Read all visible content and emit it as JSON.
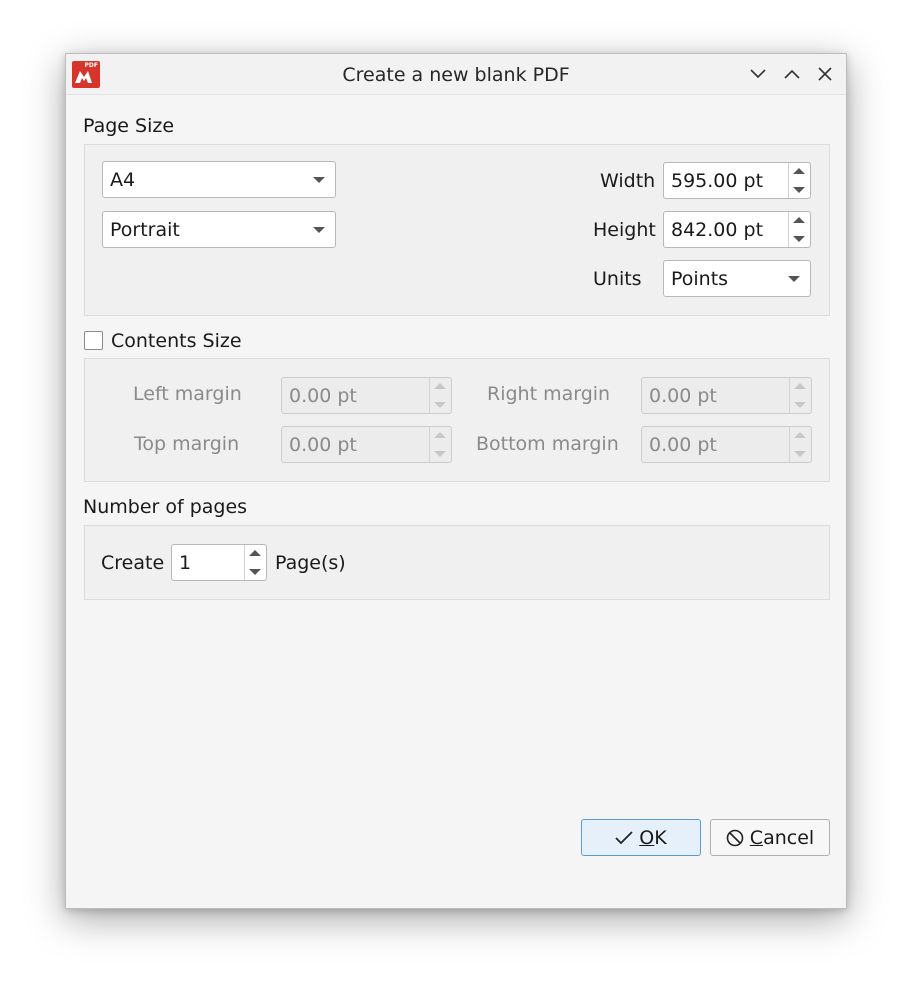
{
  "window": {
    "title": "Create a new blank PDF",
    "app_icon_tag": "PDF",
    "controls": [
      "chevron-down",
      "chevron-up",
      "close"
    ]
  },
  "page_size": {
    "group_label": "Page Size",
    "size_selected": "A4",
    "orientation_selected": "Portrait",
    "width_label": "Width",
    "width_value": "595.00 pt",
    "height_label": "Height",
    "height_value": "842.00 pt",
    "units_label": "Units",
    "units_selected": "Points"
  },
  "contents_size": {
    "checkbox_label": "Contents Size",
    "checked": false,
    "left_margin_label": "Left margin",
    "left_margin_value": "0.00 pt",
    "right_margin_label": "Right margin",
    "right_margin_value": "0.00 pt",
    "top_margin_label": "Top margin",
    "top_margin_value": "0.00 pt",
    "bottom_margin_label": "Bottom margin",
    "bottom_margin_value": "0.00 pt"
  },
  "pages": {
    "group_label": "Number of pages",
    "create_label": "Create",
    "count_value": "1",
    "unit_label": "Page(s)"
  },
  "buttons": {
    "ok_mnemonic": "O",
    "ok_rest": "K",
    "cancel_mnemonic": "C",
    "cancel_rest": "ancel"
  },
  "colors": {
    "app_icon": "#d6352b",
    "ok_border": "#5b9bd5",
    "ok_background": "#e6f0fb"
  }
}
